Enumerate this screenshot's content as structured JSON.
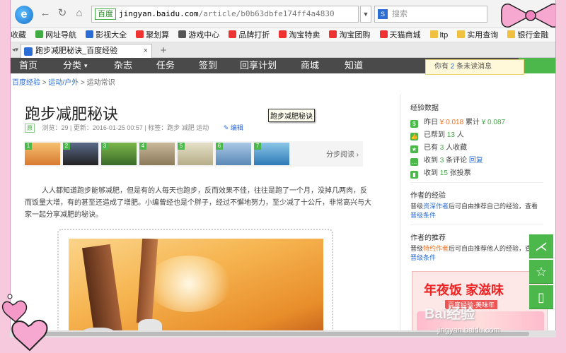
{
  "browser": {
    "url_safe_label": "百度",
    "url_host": "jingyan.baidu.com",
    "url_path": "/article/b0b63dbfe174ff4a4830",
    "search_placeholder": "搜索",
    "tab_title": "跑步减肥秘诀_百度经验"
  },
  "bookmarks": [
    {
      "label": "收藏",
      "icon": "star-icon"
    },
    {
      "label": "网址导航",
      "icon": "globe-icon"
    },
    {
      "label": "影视大全",
      "icon": "film-icon"
    },
    {
      "label": "聚划算",
      "icon": "taobao-icon"
    },
    {
      "label": "游戏中心",
      "icon": "game-icon"
    },
    {
      "label": "品牌打折",
      "icon": "taobao-icon"
    },
    {
      "label": "淘宝特卖",
      "icon": "taobao-icon"
    },
    {
      "label": "淘宝团购",
      "icon": "taobao-icon"
    },
    {
      "label": "天猫商城",
      "icon": "tmall-icon"
    },
    {
      "label": "ltp",
      "icon": "folder-icon"
    },
    {
      "label": "实用查询",
      "icon": "folder-icon"
    },
    {
      "label": "银行金融",
      "icon": "folder-icon"
    }
  ],
  "sitenav": [
    "首页",
    "分类",
    "杂志",
    "任务",
    "签到",
    "回享计划",
    "商城",
    "知道"
  ],
  "notification": {
    "prefix": "你有",
    "count": "2",
    "suffix": "条未读消息"
  },
  "breadcrumb": [
    "百度经验",
    "运动/户外",
    "运动常识"
  ],
  "article": {
    "title": "跑步减肥秘诀",
    "original_badge": "原",
    "views": "浏览：29",
    "updated": "更新：2016-01-25 00:57",
    "tags": "标签：跑步 减肥 运动",
    "edit": "编辑",
    "tooltip": "跑步减肥秘诀",
    "step_numbers": [
      "1",
      "2",
      "3",
      "4",
      "5",
      "6",
      "7"
    ],
    "steps_read": "分步阅读",
    "paragraph": "人人都知道跑步能够减肥，但是有的人每天也跑步，反而效果不佳，往往是跑了一个月，没掉几两肉，反而饭量大增，有的甚至还造成了增肥。小编曾经也是个胖子，经过不懈地努力，至少减了十公斤，非常高兴与大家一起分享减肥的秘诀。"
  },
  "sidebar": {
    "stats_title": "经验数据",
    "stats": [
      {
        "icon": "coin-icon",
        "text": "昨日",
        "v1": "¥ 0.018",
        "mid": "累计",
        "v2": "¥ 0.087"
      },
      {
        "icon": "thumb-icon",
        "text": "已帮到",
        "v1": "13",
        "mid": "人",
        "v2": ""
      },
      {
        "icon": "star-icon",
        "text": "已有",
        "v1": "3",
        "mid": "人收藏",
        "v2": ""
      },
      {
        "icon": "comment-icon",
        "text": "收到",
        "v1": "3",
        "mid": "条评论",
        "v2": "回复"
      },
      {
        "icon": "vote-icon",
        "text": "收到",
        "v1": "15",
        "mid": "张投票",
        "v2": ""
      }
    ],
    "author_exp_title": "作者的经验",
    "author_exp_text_a": "普级",
    "author_exp_link": "资深作者",
    "author_exp_text_b": "后可自由推荐自己的经验，查看",
    "author_exp_cond": "晋级条件",
    "author_rec_title": "作者的推荐",
    "author_rec_text_a": "晋级",
    "author_rec_link": "特约作者",
    "author_rec_text_b": "后可自由推荐他人的经验，查看",
    "author_rec_cond": "晋级条件",
    "ad_title": "年夜饭 家滋味",
    "ad_sub": "百度经验·美味年"
  },
  "watermark": "Bai经验",
  "watermark_url": "jingyan.baidu.com"
}
